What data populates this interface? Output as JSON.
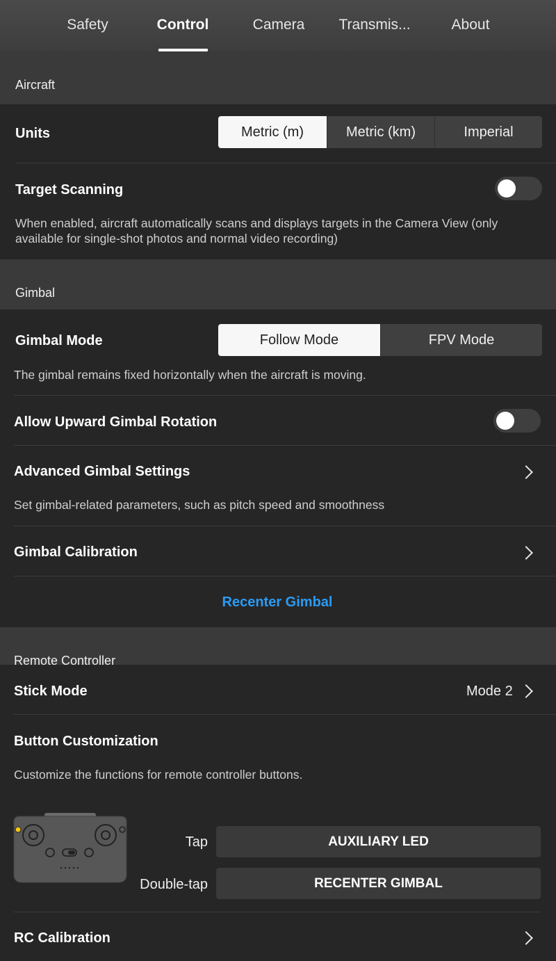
{
  "tabs": [
    {
      "label": "Safety"
    },
    {
      "label": "Control"
    },
    {
      "label": "Camera"
    },
    {
      "label": "Transmis..."
    },
    {
      "label": "About"
    }
  ],
  "active_tab": "Control",
  "aircraft": {
    "header": "Aircraft",
    "units": {
      "label": "Units",
      "options": [
        "Metric (m)",
        "Metric (km)",
        "Imperial"
      ],
      "selected": "Metric (m)"
    },
    "target_scanning": {
      "label": "Target Scanning",
      "enabled": false,
      "description": "When enabled, aircraft automatically scans and displays targets in the Camera View (only available for single-shot photos and normal video recording)"
    }
  },
  "gimbal": {
    "header": "Gimbal",
    "mode": {
      "label": "Gimbal Mode",
      "options": [
        "Follow Mode",
        "FPV Mode"
      ],
      "selected": "Follow Mode",
      "description": "The gimbal remains fixed horizontally when the aircraft is moving."
    },
    "upward_rotation": {
      "label": "Allow Upward Gimbal Rotation",
      "enabled": false
    },
    "advanced": {
      "label": "Advanced Gimbal Settings",
      "description": "Set gimbal-related parameters, such as pitch speed and smoothness"
    },
    "calibration": {
      "label": "Gimbal Calibration"
    },
    "recenter": {
      "label": "Recenter Gimbal"
    }
  },
  "remote_controller": {
    "header": "Remote Controller",
    "stick_mode": {
      "label": "Stick Mode",
      "value": "Mode 2"
    },
    "button_customization": {
      "label": "Button Customization",
      "description": "Customize the functions for remote controller buttons.",
      "tap_label": "Tap",
      "tap_value": "AUXILIARY LED",
      "double_tap_label": "Double-tap",
      "double_tap_value": "RECENTER GIMBAL"
    },
    "rc_calibration": {
      "label": "RC Calibration"
    }
  },
  "colors": {
    "accent": "#2b9bf4",
    "panel": "#262626",
    "header": "#3a3a3a",
    "indicator": "#f5c518"
  }
}
